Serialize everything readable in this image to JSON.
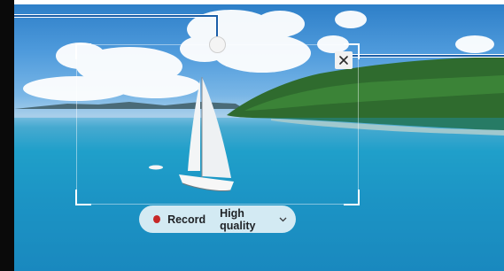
{
  "recorder": {
    "record_label": "Record",
    "quality_label": "High quality",
    "record_dot_color": "#c62828"
  },
  "icons": {
    "move_handle": "circle-handle-icon",
    "close": "close-icon",
    "quality_dropdown": "chevron-down-icon"
  },
  "colors": {
    "callout_line": "#1b5ea8"
  }
}
